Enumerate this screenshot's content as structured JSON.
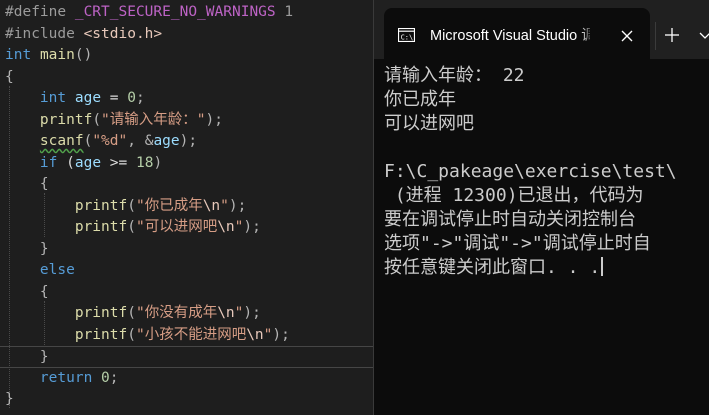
{
  "editor": {
    "lines": [
      [
        [
          "pp",
          "#define "
        ],
        [
          "mac",
          "_CRT_SECURE_NO_WARNINGS"
        ],
        [
          "pp",
          " 1"
        ]
      ],
      [
        [
          "pp",
          "#include "
        ],
        [
          "inc",
          "<stdio.h>"
        ]
      ],
      [
        [
          "kw",
          "int"
        ],
        [
          "plain",
          " "
        ],
        [
          "fn",
          "main"
        ],
        [
          "punc",
          "()"
        ]
      ],
      [
        [
          "punc",
          "{"
        ]
      ],
      [
        [
          "plain",
          "    "
        ],
        [
          "kw",
          "int"
        ],
        [
          "plain",
          " "
        ],
        [
          "var",
          "age"
        ],
        [
          "plain",
          " = "
        ],
        [
          "num",
          "0"
        ],
        [
          "punc",
          ";"
        ]
      ],
      [
        [
          "plain",
          "    "
        ],
        [
          "fn",
          "printf"
        ],
        [
          "punc",
          "("
        ],
        [
          "str",
          "\"请输入年龄：\""
        ],
        [
          "punc",
          ");"
        ]
      ],
      [
        [
          "plain",
          "    "
        ],
        [
          "fn",
          "scanf"
        ],
        [
          "punc",
          "("
        ],
        [
          "str",
          "\"%d\""
        ],
        [
          "punc",
          ", "
        ],
        [
          "punc",
          "&"
        ],
        [
          "var",
          "age"
        ],
        [
          "punc",
          ");"
        ]
      ],
      [
        [
          "plain",
          "    "
        ],
        [
          "kw",
          "if"
        ],
        [
          "plain",
          " ("
        ],
        [
          "var",
          "age"
        ],
        [
          "plain",
          " >= "
        ],
        [
          "num",
          "18"
        ],
        [
          "punc",
          ")"
        ]
      ],
      [
        [
          "plain",
          "    "
        ],
        [
          "punc",
          "{"
        ]
      ],
      [
        [
          "plain",
          "        "
        ],
        [
          "fn",
          "printf"
        ],
        [
          "punc",
          "("
        ],
        [
          "str",
          "\"你已成年"
        ],
        [
          "esc",
          "\\n"
        ],
        [
          "str",
          "\""
        ],
        [
          "punc",
          ");"
        ]
      ],
      [
        [
          "plain",
          "        "
        ],
        [
          "fn",
          "printf"
        ],
        [
          "punc",
          "("
        ],
        [
          "str",
          "\"可以进网吧"
        ],
        [
          "esc",
          "\\n"
        ],
        [
          "str",
          "\""
        ],
        [
          "punc",
          ");"
        ]
      ],
      [
        [
          "plain",
          "    "
        ],
        [
          "punc",
          "}"
        ]
      ],
      [
        [
          "plain",
          "    "
        ],
        [
          "kw",
          "else"
        ]
      ],
      [
        [
          "plain",
          "    "
        ],
        [
          "punc",
          "{"
        ]
      ],
      [
        [
          "plain",
          "        "
        ],
        [
          "fn",
          "printf"
        ],
        [
          "punc",
          "("
        ],
        [
          "str",
          "\"你没有成年"
        ],
        [
          "esc",
          "\\n"
        ],
        [
          "str",
          "\""
        ],
        [
          "punc",
          ");"
        ]
      ],
      [
        [
          "plain",
          "        "
        ],
        [
          "fn",
          "printf"
        ],
        [
          "punc",
          "("
        ],
        [
          "str",
          "\"小孩不能进网吧"
        ],
        [
          "esc",
          "\\n"
        ],
        [
          "str",
          "\""
        ],
        [
          "punc",
          ");"
        ]
      ],
      [
        [
          "plain",
          "    "
        ],
        [
          "punc",
          "}"
        ]
      ],
      [
        [
          "plain",
          "    "
        ],
        [
          "kw",
          "return"
        ],
        [
          "plain",
          " "
        ],
        [
          "num",
          "0"
        ],
        [
          "punc",
          ";"
        ]
      ],
      [
        [
          "punc",
          "}"
        ]
      ]
    ],
    "current_line": 16
  },
  "console": {
    "tab_title": "Microsoft Visual Studio 调试控制台",
    "tab_icon": "terminal-icon",
    "close_icon": "close-icon",
    "new_tab_icon": "plus-icon",
    "dropdown_icon": "chevron-down-icon",
    "output": [
      "请输入年龄： 22",
      "你已成年",
      "可以进网吧",
      "",
      "F:\\C_pakeage\\exercise\\test\\",
      " (进程 12300)已退出，代码为",
      "要在调试停止时自动关闭控制台",
      "选项\"->\"调试\"->\"调试停止时自",
      "按任意键关闭此窗口. . ."
    ]
  },
  "colors": {
    "editor_bg": "#1e1e1e",
    "console_bg": "#0c0c0c",
    "titlebar_bg": "#202020",
    "keyword": "#569cd6",
    "function": "#dcdcaa",
    "string": "#d69d85"
  }
}
